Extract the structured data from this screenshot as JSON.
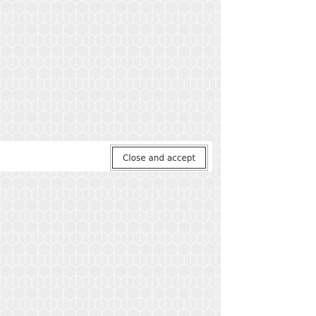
{
  "background": {
    "pattern": "hexagon-lattice",
    "pattern_color": "#ececec",
    "line_color": "#f7f7f7",
    "side_panel_color": "#ffffff"
  },
  "dialog": {
    "close_accept_label": "Close and accept"
  }
}
